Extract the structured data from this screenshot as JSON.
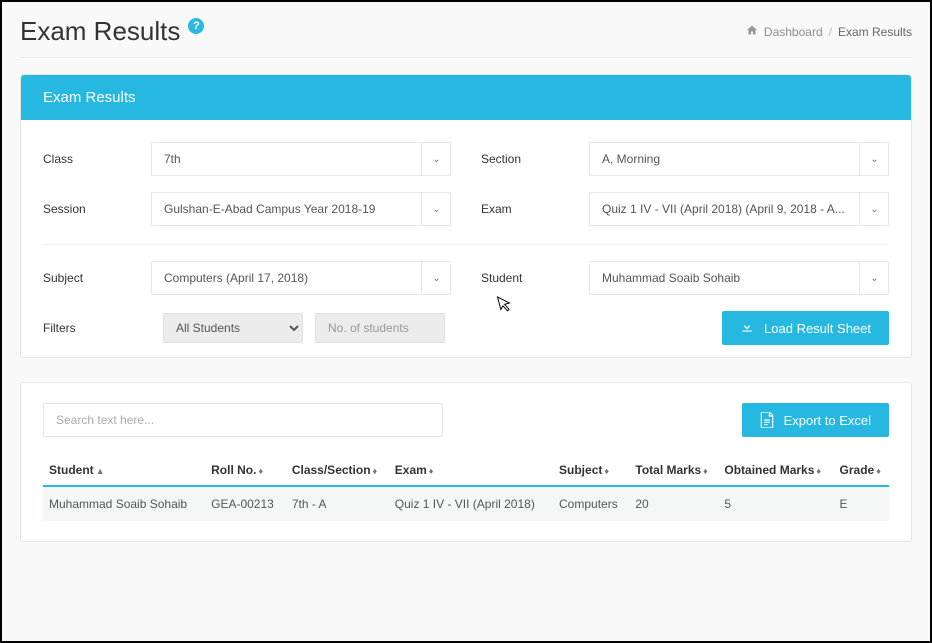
{
  "header": {
    "title": "Exam Results",
    "breadcrumb": {
      "dashboard": "Dashboard",
      "current": "Exam Results"
    }
  },
  "panel": {
    "title": "Exam Results",
    "fields": {
      "class_label": "Class",
      "class_value": "7th",
      "section_label": "Section",
      "section_value": "A, Morning",
      "session_label": "Session",
      "session_value": "Gulshan-E-Abad Campus Year 2018-19",
      "exam_label": "Exam",
      "exam_value": "Quiz 1 IV - VII (April 2018) (April 9, 2018 - A...",
      "subject_label": "Subject",
      "subject_value": "Computers (April 17, 2018)",
      "student_label": "Student",
      "student_value": "Muhammad Soaib Sohaib",
      "filters_label": "Filters",
      "filters_select": "All Students",
      "students_placeholder": "No. of students",
      "load_button": "Load Result Sheet"
    }
  },
  "results": {
    "search_placeholder": "Search text here...",
    "export_label": "Export to Excel",
    "columns": {
      "student": "Student",
      "roll": "Roll No.",
      "classsec": "Class/Section",
      "exam": "Exam",
      "subject": "Subject",
      "total": "Total Marks",
      "obtained": "Obtained Marks",
      "grade": "Grade"
    },
    "rows": [
      {
        "student": "Muhammad Soaib Sohaib",
        "roll": "GEA-00213",
        "classsec": "7th - A",
        "exam": "Quiz 1 IV - VII (April 2018)",
        "subject": "Computers",
        "total": "20",
        "obtained": "5",
        "grade": "E"
      }
    ]
  }
}
